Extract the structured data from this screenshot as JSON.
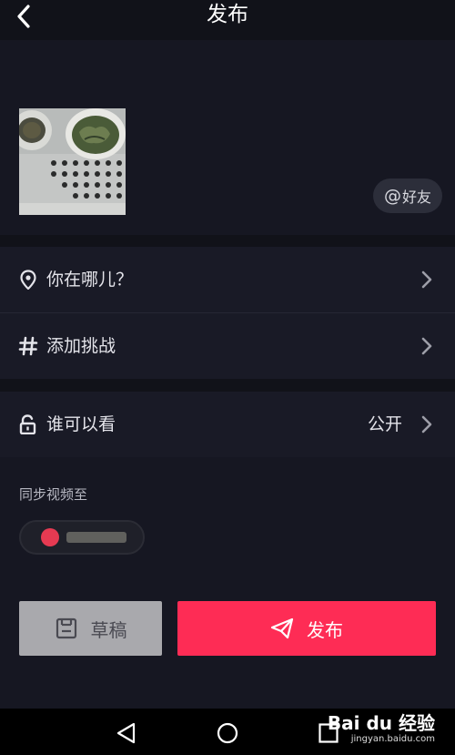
{
  "header": {
    "title": "发布",
    "back_icon": "chevron-left-icon"
  },
  "media": {
    "thumbnail_alt": "tea cups on tray",
    "mention_chip": {
      "at": "@",
      "label": "好友"
    }
  },
  "options": [
    {
      "icon": "location-pin-icon",
      "label": "你在哪儿？",
      "value": ""
    },
    {
      "icon": "hashtag-icon",
      "label": "添加挑战",
      "value": ""
    }
  ],
  "privacy": {
    "icon": "unlock-icon",
    "label": "谁可以看",
    "value": "公开"
  },
  "sync": {
    "title": "同步视频至"
  },
  "actions": {
    "draft_label": "草稿",
    "publish_label": "发布"
  },
  "colors": {
    "accent": "#fe2c55",
    "background": "#161722",
    "row": "#191a26"
  },
  "watermark": {
    "main": "Bai du 经验",
    "sub": "jingyan.baidu.com"
  }
}
